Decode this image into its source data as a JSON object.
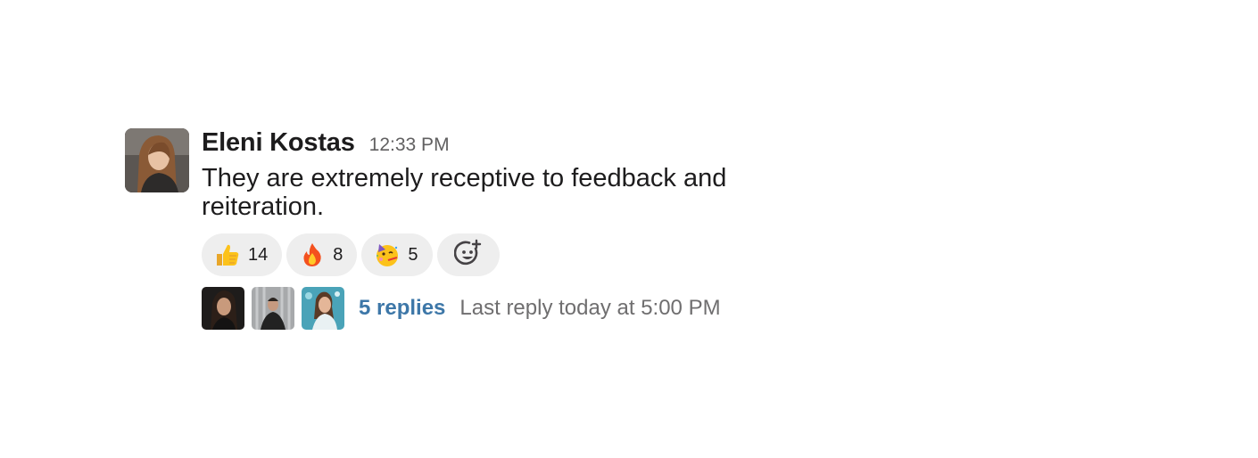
{
  "message": {
    "author": "Eleni Kostas",
    "timestamp": "12:33 PM",
    "text": "They are extremely receptive to feedback and reiteration."
  },
  "reactions": [
    {
      "icon": "thumbs-up-icon",
      "count": "14"
    },
    {
      "icon": "fire-icon",
      "count": "8"
    },
    {
      "icon": "party-face-icon",
      "count": "5"
    }
  ],
  "add_reaction": {
    "icon": "add-emoji-icon"
  },
  "thread": {
    "replies_label": "5 replies",
    "last_reply": "Last reply today at 5:00 PM",
    "participants": [
      "participant-1",
      "participant-2",
      "participant-3"
    ]
  },
  "colors": {
    "link": "#3d77a8",
    "muted": "#616061",
    "pill_bg": "#eeeeee",
    "text": "#1d1c1d"
  }
}
